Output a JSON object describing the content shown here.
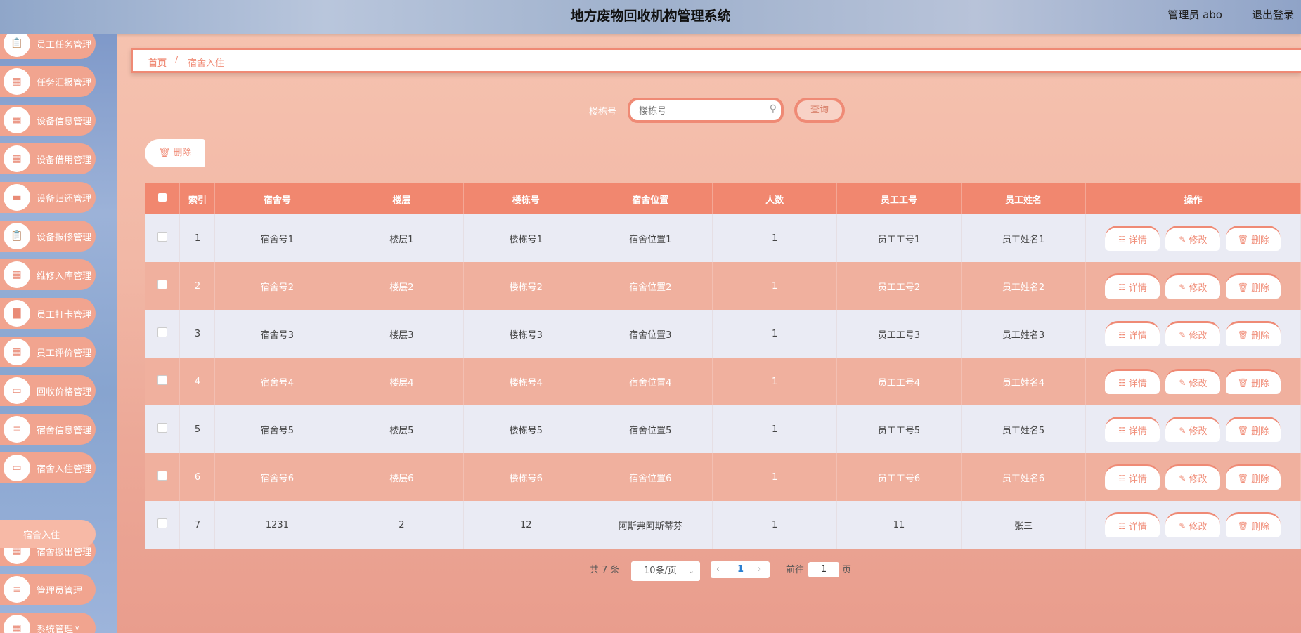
{
  "header": {
    "title": "地方废物回收机构管理系统",
    "user": "管理员 abo",
    "logout": "退出登录"
  },
  "sidebar": {
    "items": [
      {
        "label": "员工任务管理",
        "icon": "clipboard-icon"
      },
      {
        "label": "任务汇报管理",
        "icon": "grid-icon"
      },
      {
        "label": "设备信息管理",
        "icon": "grid-icon"
      },
      {
        "label": "设备借用管理",
        "icon": "grid-icon"
      },
      {
        "label": "设备归还管理",
        "icon": "message-icon"
      },
      {
        "label": "设备报修管理",
        "icon": "clipboard-icon"
      },
      {
        "label": "维修入库管理",
        "icon": "grid-icon"
      },
      {
        "label": "员工打卡管理",
        "icon": "chart-icon"
      },
      {
        "label": "员工评价管理",
        "icon": "grid-icon"
      },
      {
        "label": "回收价格管理",
        "icon": "monitor-icon"
      },
      {
        "label": "宿舍信息管理",
        "icon": "list-icon"
      },
      {
        "label": "宿舍入住管理",
        "icon": "monitor-icon"
      },
      {
        "label": "宿舍搬出管理",
        "icon": "grid-icon"
      },
      {
        "label": "管理员管理",
        "icon": "list-icon"
      },
      {
        "label": "系统管理",
        "icon": "grid-icon"
      }
    ],
    "sub_item": "宿舍入住"
  },
  "breadcrumb": {
    "home": "首页",
    "separator": "/",
    "current": "宿舍入住"
  },
  "search": {
    "label": "楼栋号",
    "placeholder": "楼栋号",
    "button": "查询"
  },
  "toolbar": {
    "delete_label": "删除"
  },
  "table": {
    "headers": [
      "索引",
      "宿舍号",
      "楼层",
      "楼栋号",
      "宿舍位置",
      "人数",
      "员工工号",
      "员工姓名",
      "操作"
    ],
    "rows": [
      [
        "1",
        "宿舍号1",
        "楼层1",
        "楼栋号1",
        "宿舍位置1",
        "1",
        "员工工号1",
        "员工姓名1"
      ],
      [
        "2",
        "宿舍号2",
        "楼层2",
        "楼栋号2",
        "宿舍位置2",
        "1",
        "员工工号2",
        "员工姓名2"
      ],
      [
        "3",
        "宿舍号3",
        "楼层3",
        "楼栋号3",
        "宿舍位置3",
        "1",
        "员工工号3",
        "员工姓名3"
      ],
      [
        "4",
        "宿舍号4",
        "楼层4",
        "楼栋号4",
        "宿舍位置4",
        "1",
        "员工工号4",
        "员工姓名4"
      ],
      [
        "5",
        "宿舍号5",
        "楼层5",
        "楼栋号5",
        "宿舍位置5",
        "1",
        "员工工号5",
        "员工姓名5"
      ],
      [
        "6",
        "宿舍号6",
        "楼层6",
        "楼栋号6",
        "宿舍位置6",
        "1",
        "员工工号6",
        "员工姓名6"
      ],
      [
        "7",
        "1231",
        "2",
        "12",
        "阿斯弗阿斯蒂芬",
        "1",
        "11",
        "张三"
      ]
    ],
    "actions": {
      "detail": "详情",
      "edit": "修改",
      "delete": "删除"
    }
  },
  "pagination": {
    "total": "共 7 条",
    "page_size": "10条/页",
    "current_page": "1",
    "goto_prefix": "前往",
    "goto_value": "1",
    "goto_suffix": "页"
  },
  "colors": {
    "accent": "#f1876f",
    "odd_row": "#eaebf4",
    "even_row": "#f0b09e"
  }
}
